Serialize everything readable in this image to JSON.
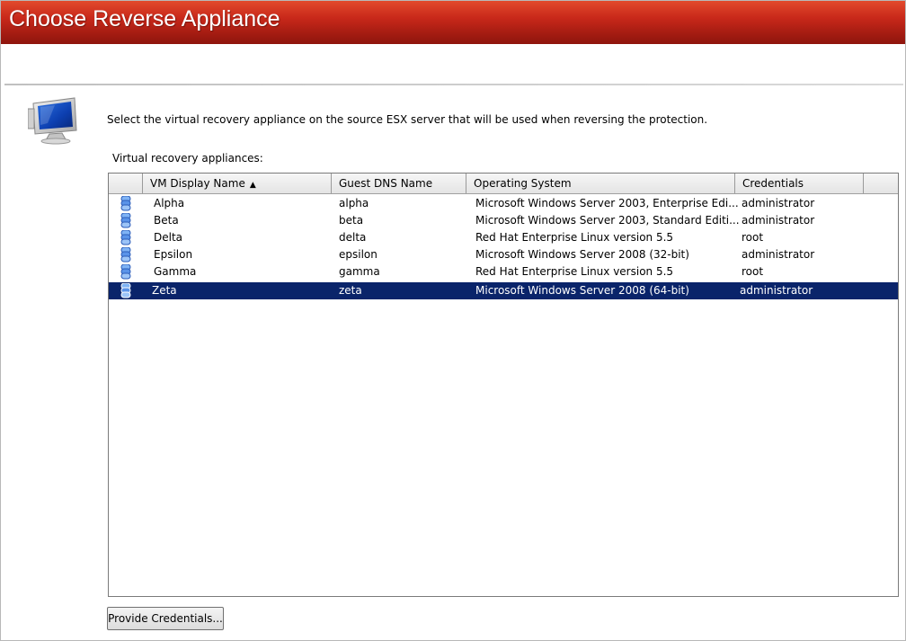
{
  "window": {
    "title": "Choose Reverse Appliance"
  },
  "main": {
    "instructions": "Select the virtual recovery appliance on the source ESX server that will be used when reversing the protection.",
    "list_label": "Virtual recovery appliances:",
    "icon": "computer-monitor-icon"
  },
  "table": {
    "columns": [
      {
        "label": "VM Display Name",
        "sort": "ascending"
      },
      {
        "label": "Guest DNS Name"
      },
      {
        "label": "Operating System"
      },
      {
        "label": "Credentials"
      }
    ],
    "row_icon": "vm-appliance-icon",
    "selected_row": 5,
    "rows": [
      {
        "vm": "Alpha",
        "dns": "alpha",
        "os": "Microsoft Windows Server 2003, Enterprise Edi...",
        "cred": "administrator"
      },
      {
        "vm": "Beta",
        "dns": "beta",
        "os": "Microsoft Windows Server 2003, Standard Editi...",
        "cred": "administrator"
      },
      {
        "vm": "Delta",
        "dns": "delta",
        "os": "Red Hat Enterprise Linux version 5.5",
        "cred": "root"
      },
      {
        "vm": "Epsilon",
        "dns": "epsilon",
        "os": "Microsoft Windows Server 2008 (32-bit)",
        "cred": "administrator"
      },
      {
        "vm": "Gamma",
        "dns": "gamma",
        "os": "Red Hat Enterprise Linux version 5.5",
        "cred": "root"
      },
      {
        "vm": "Zeta",
        "dns": "zeta",
        "os": "Microsoft Windows Server 2008 (64-bit)",
        "cred": "administrator"
      }
    ]
  },
  "footer": {
    "provide_credentials_label": "Provide Credentials..."
  },
  "colors": {
    "title_bar": "#b3231a",
    "selection": "#0a246a"
  }
}
